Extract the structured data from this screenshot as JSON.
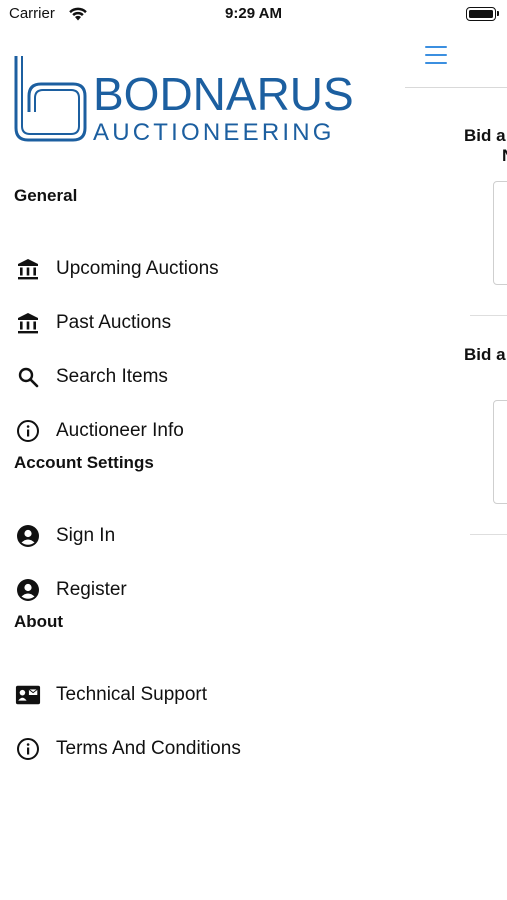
{
  "status_bar": {
    "carrier": "Carrier",
    "time": "9:29 AM"
  },
  "logo": {
    "line1": "BODNARUS",
    "line2": "AUCTIONEERING",
    "color": "#1c5fa0"
  },
  "sections": {
    "general": {
      "title": "General",
      "items": [
        {
          "label": "Upcoming Auctions",
          "icon": "bank-icon"
        },
        {
          "label": "Past Auctions",
          "icon": "bank-icon"
        },
        {
          "label": "Search Items",
          "icon": "search-icon"
        },
        {
          "label": "Auctioneer Info",
          "icon": "info-icon"
        }
      ]
    },
    "account": {
      "title": "Account Settings",
      "items": [
        {
          "label": "Sign In",
          "icon": "account-circle-icon"
        },
        {
          "label": "Register",
          "icon": "account-circle-icon"
        }
      ]
    },
    "about": {
      "title": "About",
      "items": [
        {
          "label": "Technical Support",
          "icon": "contact-card-icon"
        },
        {
          "label": "Terms And Conditions",
          "icon": "info-icon"
        }
      ]
    }
  },
  "main_panel": {
    "accent": "#3b8fe0",
    "bid_label_1": "Bid a",
    "bid_label_1_sub": "N",
    "bid_label_2": "Bid a"
  }
}
